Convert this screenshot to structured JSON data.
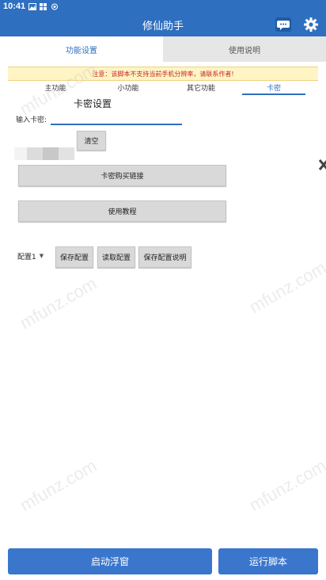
{
  "status_bar": {
    "time": "10:41"
  },
  "app_bar": {
    "title": "修仙助手"
  },
  "tabs": [
    {
      "label": "功能设置",
      "active": true
    },
    {
      "label": "使用说明",
      "active": false
    }
  ],
  "notice": "注意：该脚本不支持当前手机分辨率，请联系作者!",
  "sub_tabs": [
    {
      "label": "主功能",
      "active": false
    },
    {
      "label": "小功能",
      "active": false
    },
    {
      "label": "其它功能",
      "active": false
    },
    {
      "label": "卡密",
      "active": true
    }
  ],
  "card_settings": {
    "title": "卡密设置",
    "input_label": "输入卡密:",
    "input_value": "",
    "clear_button": "清空",
    "buy_link_button": "卡密购买链接",
    "tutorial_button": "使用教程"
  },
  "config": {
    "selected": "配置1",
    "save_button": "保存配置",
    "load_button": "读取配置",
    "help_button": "保存配置说明"
  },
  "bottom": {
    "float_window_button": "启动浮窗",
    "run_script_button": "运行脚本"
  },
  "watermark": "mfunz.com",
  "colors": {
    "primary": "#2f6fc0",
    "notice_text": "#c62828",
    "notice_bg": "#fff4c4"
  }
}
